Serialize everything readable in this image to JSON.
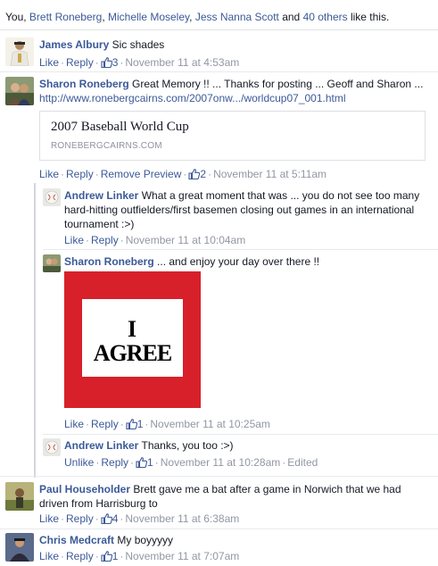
{
  "likes": {
    "prefix": "You, ",
    "names": [
      "Brett Roneberg",
      "Michelle Moseley",
      "Jess Nanna Scott"
    ],
    "comma": ", ",
    "and": " and ",
    "others": "40 others",
    "suffix": " like this."
  },
  "comments": [
    {
      "author": "James Albury",
      "text": "Sic shades",
      "like": "Like",
      "reply": "Reply",
      "likes": "3",
      "time": "November 11 at 4:53am"
    },
    {
      "author": "Sharon Roneberg",
      "text": "Great Memory !! ... Thanks for posting ... Geoff and Sharon ...",
      "url": "http://www.ronebergcairns.com/2007onw.../worldcup07_001.html",
      "preview": {
        "title": "2007 Baseball World Cup",
        "host": "RONEBERGCAIRNS.COM"
      },
      "like": "Like",
      "reply": "Reply",
      "remove_preview": "Remove Preview",
      "likes": "2",
      "time": "November 11 at 5:11am"
    },
    {
      "author": "Paul Householder",
      "text": "Brett gave me a bat after a game in Norwich that we had driven from Harrisburg to",
      "like": "Like",
      "reply": "Reply",
      "likes": "4",
      "time": "November 11 at 6:38am"
    },
    {
      "author": "Chris Medcraft",
      "text": "My boyyyyy",
      "like": "Like",
      "reply": "Reply",
      "likes": "1",
      "time": "November 11 at 7:07am"
    }
  ],
  "replies": [
    {
      "author": "Andrew Linker",
      "text": "What a great moment that was ... you do not see too many hard-hitting outfielders/first basemen closing out games in an international tournament :>)",
      "like": "Like",
      "reply": "Reply",
      "time": "November 11 at 10:04am"
    },
    {
      "author": "Sharon Roneberg",
      "text": "... and enjoy your day over there !!",
      "image": {
        "line1": "I",
        "line2": "AGREE"
      },
      "like": "Like",
      "reply": "Reply",
      "likes": "1",
      "time": "November 11 at 10:25am"
    },
    {
      "author": "Andrew Linker",
      "text": "Thanks, you too :>)",
      "like": "Unlike",
      "reply": "Reply",
      "likes": "1",
      "time": "November 11 at 10:28am",
      "edited": "Edited"
    }
  ],
  "colors": {
    "link": "#3b5998",
    "meta": "#9197a3",
    "agree_red": "#d7202a"
  },
  "icons": {
    "like_count": "thumbs-up-icon"
  }
}
